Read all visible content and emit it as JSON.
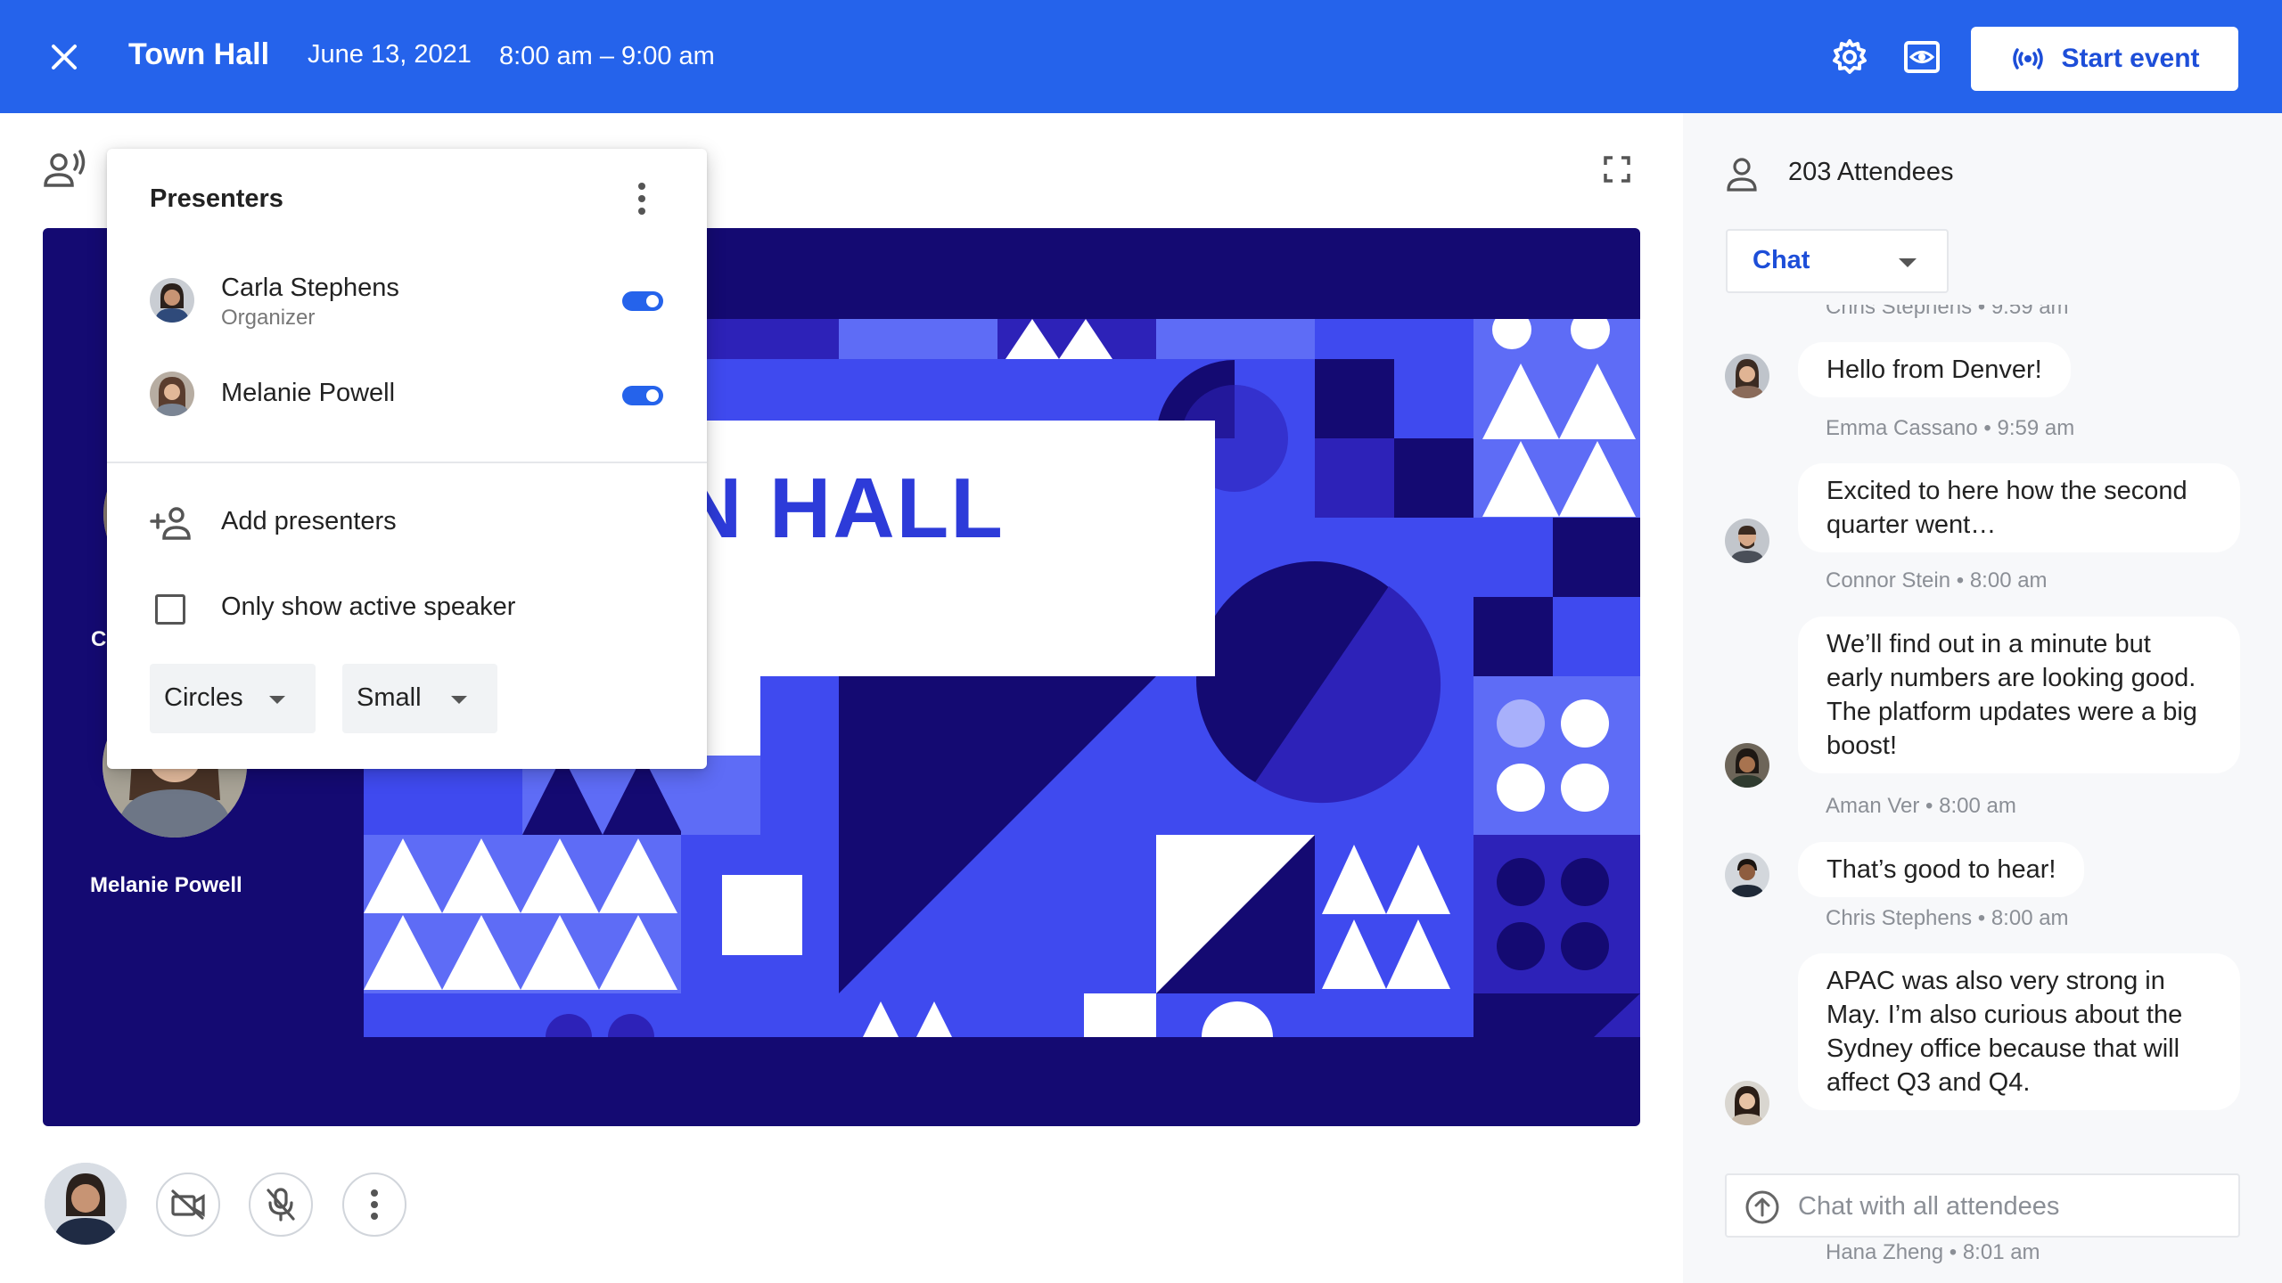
{
  "header": {
    "title": "Town Hall",
    "date": "June 13, 2021",
    "time": "8:00 am – 9:00 am",
    "start_label": "Start event",
    "icons": {
      "close": "close-icon",
      "settings": "gear-icon",
      "view": "eye-screen-icon",
      "broadcast": "broadcast-icon"
    },
    "color": "#2563eb"
  },
  "stage": {
    "slide_text": "N HALL",
    "side_presenters": [
      {
        "label": "C"
      },
      {
        "label": "Melanie Powell"
      }
    ],
    "colors": {
      "background": "#140a72",
      "primary": "#3f4aef",
      "light": "#5e6cf6",
      "dark": "#2d22b8"
    }
  },
  "presenters_popup": {
    "title": "Presenters",
    "presenters": [
      {
        "name": "Carla Stephens",
        "role": "Organizer",
        "enabled": true
      },
      {
        "name": "Melanie Powell",
        "role": "",
        "enabled": true
      }
    ],
    "add_label": "Add presenters",
    "active_speaker_label": "Only show active speaker",
    "active_speaker_checked": false,
    "shape_select": "Circles",
    "size_select": "Small"
  },
  "controls": {
    "camera": "camera-off-icon",
    "mic": "mic-off-icon",
    "more": "more-vertical-icon"
  },
  "sidebar": {
    "attendees": "203 Attendees",
    "chat_mode": "Chat",
    "messages": [
      {
        "author": "",
        "text": "",
        "meta": "Chris Stephens • 9:59 am"
      },
      {
        "author": "Emma Cassano",
        "text": "Hello from Denver!",
        "meta": "Emma Cassano • 9:59 am"
      },
      {
        "author": "Connor Stein",
        "text": "Excited to here how the second quarter went…",
        "meta": "Connor Stein • 8:00 am"
      },
      {
        "author": "Aman Ver",
        "text": "We’ll find out in a minute but early numbers are looking good. The platform updates were a big boost!",
        "meta": "Aman Ver • 8:00 am"
      },
      {
        "author": "Chris Stephens",
        "text": "That’s good to hear!",
        "meta": "Chris Stephens • 8:00 am"
      },
      {
        "author": "Hana Zheng",
        "text": "APAC was also very strong in May. I’m also curious about the Sydney office because that will affect Q3 and Q4.",
        "meta": "Hana Zheng • 8:01 am"
      }
    ],
    "input_placeholder": "Chat with all attendees"
  }
}
